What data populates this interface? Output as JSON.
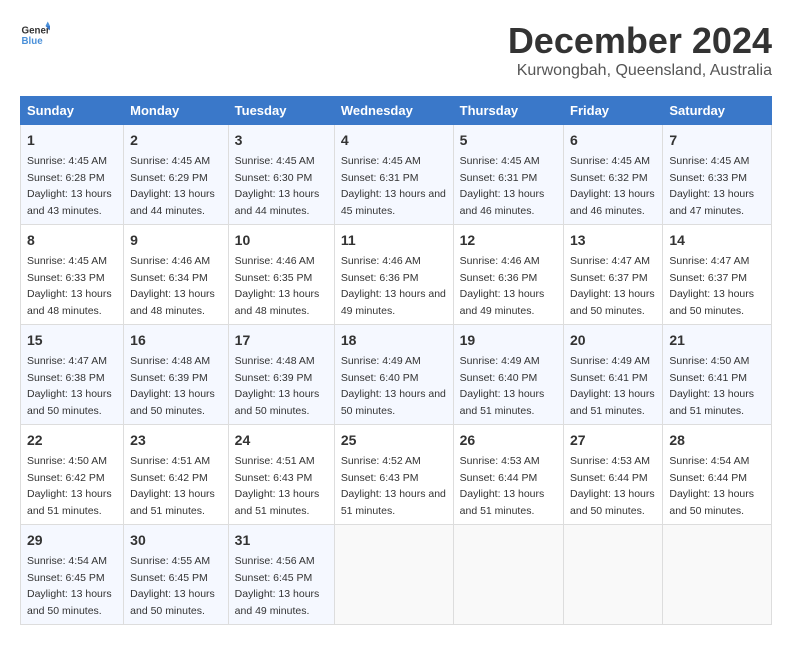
{
  "logo": {
    "text_general": "General",
    "text_blue": "Blue"
  },
  "title": "December 2024",
  "subtitle": "Kurwongbah, Queensland, Australia",
  "days_of_week": [
    "Sunday",
    "Monday",
    "Tuesday",
    "Wednesday",
    "Thursday",
    "Friday",
    "Saturday"
  ],
  "weeks": [
    [
      {
        "day": "1",
        "sunrise": "Sunrise: 4:45 AM",
        "sunset": "Sunset: 6:28 PM",
        "daylight": "Daylight: 13 hours and 43 minutes."
      },
      {
        "day": "2",
        "sunrise": "Sunrise: 4:45 AM",
        "sunset": "Sunset: 6:29 PM",
        "daylight": "Daylight: 13 hours and 44 minutes."
      },
      {
        "day": "3",
        "sunrise": "Sunrise: 4:45 AM",
        "sunset": "Sunset: 6:30 PM",
        "daylight": "Daylight: 13 hours and 44 minutes."
      },
      {
        "day": "4",
        "sunrise": "Sunrise: 4:45 AM",
        "sunset": "Sunset: 6:31 PM",
        "daylight": "Daylight: 13 hours and 45 minutes."
      },
      {
        "day": "5",
        "sunrise": "Sunrise: 4:45 AM",
        "sunset": "Sunset: 6:31 PM",
        "daylight": "Daylight: 13 hours and 46 minutes."
      },
      {
        "day": "6",
        "sunrise": "Sunrise: 4:45 AM",
        "sunset": "Sunset: 6:32 PM",
        "daylight": "Daylight: 13 hours and 46 minutes."
      },
      {
        "day": "7",
        "sunrise": "Sunrise: 4:45 AM",
        "sunset": "Sunset: 6:33 PM",
        "daylight": "Daylight: 13 hours and 47 minutes."
      }
    ],
    [
      {
        "day": "8",
        "sunrise": "Sunrise: 4:45 AM",
        "sunset": "Sunset: 6:33 PM",
        "daylight": "Daylight: 13 hours and 48 minutes."
      },
      {
        "day": "9",
        "sunrise": "Sunrise: 4:46 AM",
        "sunset": "Sunset: 6:34 PM",
        "daylight": "Daylight: 13 hours and 48 minutes."
      },
      {
        "day": "10",
        "sunrise": "Sunrise: 4:46 AM",
        "sunset": "Sunset: 6:35 PM",
        "daylight": "Daylight: 13 hours and 48 minutes."
      },
      {
        "day": "11",
        "sunrise": "Sunrise: 4:46 AM",
        "sunset": "Sunset: 6:36 PM",
        "daylight": "Daylight: 13 hours and 49 minutes."
      },
      {
        "day": "12",
        "sunrise": "Sunrise: 4:46 AM",
        "sunset": "Sunset: 6:36 PM",
        "daylight": "Daylight: 13 hours and 49 minutes."
      },
      {
        "day": "13",
        "sunrise": "Sunrise: 4:47 AM",
        "sunset": "Sunset: 6:37 PM",
        "daylight": "Daylight: 13 hours and 50 minutes."
      },
      {
        "day": "14",
        "sunrise": "Sunrise: 4:47 AM",
        "sunset": "Sunset: 6:37 PM",
        "daylight": "Daylight: 13 hours and 50 minutes."
      }
    ],
    [
      {
        "day": "15",
        "sunrise": "Sunrise: 4:47 AM",
        "sunset": "Sunset: 6:38 PM",
        "daylight": "Daylight: 13 hours and 50 minutes."
      },
      {
        "day": "16",
        "sunrise": "Sunrise: 4:48 AM",
        "sunset": "Sunset: 6:39 PM",
        "daylight": "Daylight: 13 hours and 50 minutes."
      },
      {
        "day": "17",
        "sunrise": "Sunrise: 4:48 AM",
        "sunset": "Sunset: 6:39 PM",
        "daylight": "Daylight: 13 hours and 50 minutes."
      },
      {
        "day": "18",
        "sunrise": "Sunrise: 4:49 AM",
        "sunset": "Sunset: 6:40 PM",
        "daylight": "Daylight: 13 hours and 50 minutes."
      },
      {
        "day": "19",
        "sunrise": "Sunrise: 4:49 AM",
        "sunset": "Sunset: 6:40 PM",
        "daylight": "Daylight: 13 hours and 51 minutes."
      },
      {
        "day": "20",
        "sunrise": "Sunrise: 4:49 AM",
        "sunset": "Sunset: 6:41 PM",
        "daylight": "Daylight: 13 hours and 51 minutes."
      },
      {
        "day": "21",
        "sunrise": "Sunrise: 4:50 AM",
        "sunset": "Sunset: 6:41 PM",
        "daylight": "Daylight: 13 hours and 51 minutes."
      }
    ],
    [
      {
        "day": "22",
        "sunrise": "Sunrise: 4:50 AM",
        "sunset": "Sunset: 6:42 PM",
        "daylight": "Daylight: 13 hours and 51 minutes."
      },
      {
        "day": "23",
        "sunrise": "Sunrise: 4:51 AM",
        "sunset": "Sunset: 6:42 PM",
        "daylight": "Daylight: 13 hours and 51 minutes."
      },
      {
        "day": "24",
        "sunrise": "Sunrise: 4:51 AM",
        "sunset": "Sunset: 6:43 PM",
        "daylight": "Daylight: 13 hours and 51 minutes."
      },
      {
        "day": "25",
        "sunrise": "Sunrise: 4:52 AM",
        "sunset": "Sunset: 6:43 PM",
        "daylight": "Daylight: 13 hours and 51 minutes."
      },
      {
        "day": "26",
        "sunrise": "Sunrise: 4:53 AM",
        "sunset": "Sunset: 6:44 PM",
        "daylight": "Daylight: 13 hours and 51 minutes."
      },
      {
        "day": "27",
        "sunrise": "Sunrise: 4:53 AM",
        "sunset": "Sunset: 6:44 PM",
        "daylight": "Daylight: 13 hours and 50 minutes."
      },
      {
        "day": "28",
        "sunrise": "Sunrise: 4:54 AM",
        "sunset": "Sunset: 6:44 PM",
        "daylight": "Daylight: 13 hours and 50 minutes."
      }
    ],
    [
      {
        "day": "29",
        "sunrise": "Sunrise: 4:54 AM",
        "sunset": "Sunset: 6:45 PM",
        "daylight": "Daylight: 13 hours and 50 minutes."
      },
      {
        "day": "30",
        "sunrise": "Sunrise: 4:55 AM",
        "sunset": "Sunset: 6:45 PM",
        "daylight": "Daylight: 13 hours and 50 minutes."
      },
      {
        "day": "31",
        "sunrise": "Sunrise: 4:56 AM",
        "sunset": "Sunset: 6:45 PM",
        "daylight": "Daylight: 13 hours and 49 minutes."
      },
      null,
      null,
      null,
      null
    ]
  ]
}
